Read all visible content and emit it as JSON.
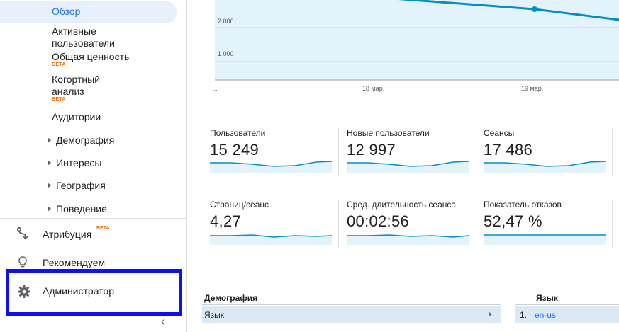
{
  "sidebar": {
    "items": [
      {
        "label": "Обзор"
      },
      {
        "label": "Активные пользователи"
      },
      {
        "label": "Общая ценность",
        "badge": "БЕТА"
      },
      {
        "label": "Когортный анализ",
        "badge": "БЕТА"
      },
      {
        "label": "Аудитории"
      },
      {
        "label": "Демография"
      },
      {
        "label": "Интересы"
      },
      {
        "label": "География"
      },
      {
        "label": "Поведение"
      }
    ],
    "sections": {
      "attribution": {
        "label": "Атрибуция",
        "badge": "БЕТА"
      },
      "recommend": {
        "label": "Рекомендуем"
      },
      "admin": {
        "label": "Администратор"
      }
    },
    "collapse_glyph": "‹"
  },
  "chart": {
    "y_ticks": [
      "2 000",
      "1 000"
    ],
    "x_ticks": [
      "...",
      "18 мар.",
      "19 мар."
    ],
    "line_color": "#058dc7",
    "fill_color": "#e3f3fb"
  },
  "metrics": [
    {
      "label": "Пользователи",
      "value": "15 249"
    },
    {
      "label": "Новые пользователи",
      "value": "12 997"
    },
    {
      "label": "Сеансы",
      "value": "17 486"
    },
    {
      "label": "Страниц/сеанс",
      "value": "4,27"
    },
    {
      "label": "Сред. длительность сеанса",
      "value": "00:02:56"
    },
    {
      "label": "Показатель отказов",
      "value": "52,47 %"
    }
  ],
  "demographics": {
    "header": "Демография",
    "row": "Язык"
  },
  "language": {
    "header": "Язык",
    "rows": [
      {
        "index": "1.",
        "value": "en-us"
      }
    ]
  },
  "colors": {
    "accent": "#1a73e8",
    "beta": "#e8710a",
    "highlight_box": "#1010ee"
  }
}
